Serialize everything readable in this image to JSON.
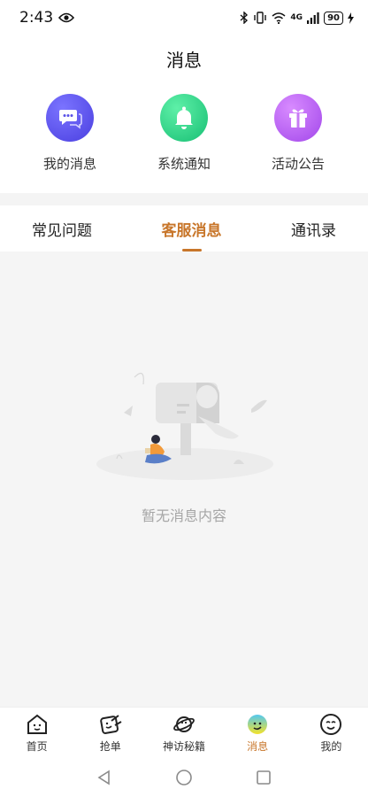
{
  "status_bar": {
    "time": "2:43",
    "network": "4G",
    "battery": "90"
  },
  "header": {
    "title": "消息"
  },
  "categories": [
    {
      "label": "我的消息",
      "icon": "chat-bubble-icon",
      "color": "#5b53e8"
    },
    {
      "label": "系统通知",
      "icon": "bell-icon",
      "color": "#2fcf8a"
    },
    {
      "label": "活动公告",
      "icon": "gift-icon",
      "color": "#b65ff0"
    }
  ],
  "tabs": [
    {
      "label": "常见问题",
      "active": false
    },
    {
      "label": "客服消息",
      "active": true
    },
    {
      "label": "通讯录",
      "active": false
    }
  ],
  "empty_state": {
    "text": "暂无消息内容"
  },
  "bottom_nav": [
    {
      "label": "首页",
      "icon": "home-icon",
      "active": false
    },
    {
      "label": "抢单",
      "icon": "grab-order-icon",
      "active": false
    },
    {
      "label": "神访秘籍",
      "icon": "planet-icon",
      "active": false
    },
    {
      "label": "消息",
      "icon": "message-face-icon",
      "active": true
    },
    {
      "label": "我的",
      "icon": "profile-face-icon",
      "active": false
    }
  ],
  "colors": {
    "accent": "#c8762a",
    "background": "#f5f5f5"
  }
}
